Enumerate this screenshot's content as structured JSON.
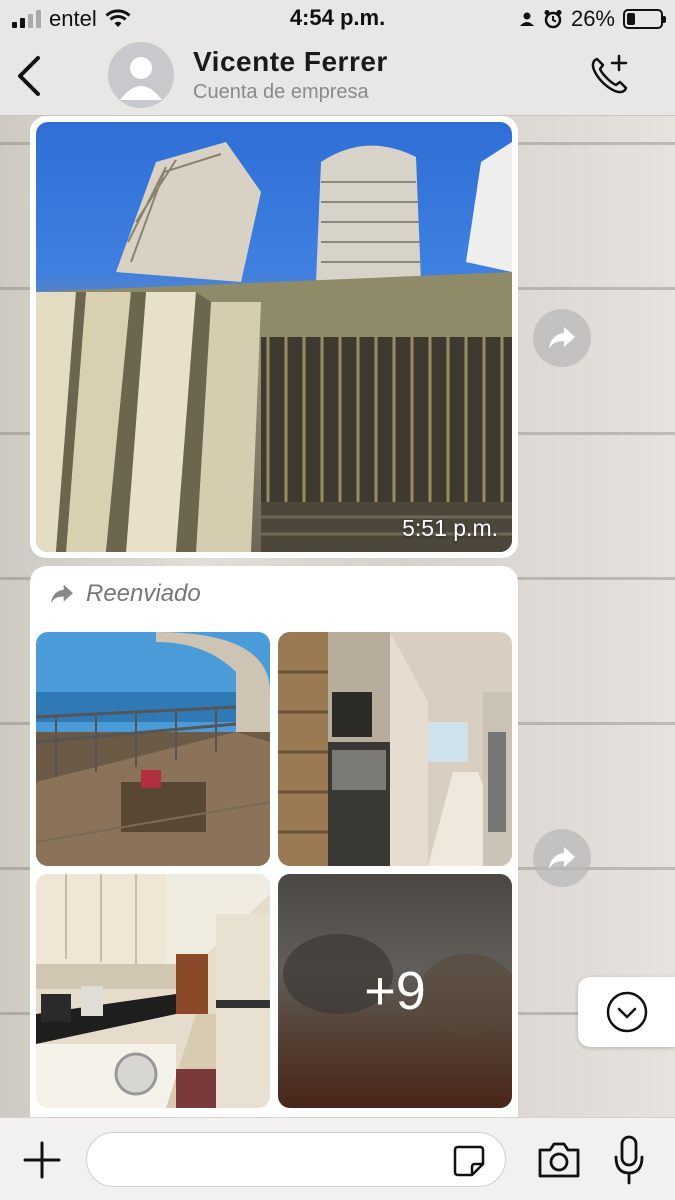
{
  "status_bar": {
    "carrier": "entel",
    "time": "4:54 p.m.",
    "battery_percent": "26%",
    "battery_level": 0.26,
    "icons": [
      "signal-icon",
      "wifi-icon",
      "person-icon",
      "alarm-icon",
      "battery-icon"
    ]
  },
  "header": {
    "contact_name": "Vicente  Ferrer",
    "subtitle": "Cuenta de empresa",
    "icons": [
      "back-chevron-icon",
      "avatar-icon",
      "add-call-icon"
    ]
  },
  "messages": [
    {
      "type": "image",
      "timestamp": "5:51 p.m.",
      "image": "building-towers-photo"
    },
    {
      "type": "album",
      "forwarded_label": "Reenviado",
      "images": [
        "balcony-photo",
        "kitchen-oven-photo",
        "kitchen-counter-photo",
        "blurred-room-photo"
      ],
      "more_count": "+9"
    }
  ],
  "input_bar": {
    "placeholder": "",
    "icons": [
      "plus-icon",
      "sticker-icon",
      "camera-icon",
      "microphone-icon"
    ]
  },
  "colors": {
    "bubble": "#ffffff",
    "header_bg": "#e9e7e5",
    "subtitle": "#8a8a8a"
  }
}
